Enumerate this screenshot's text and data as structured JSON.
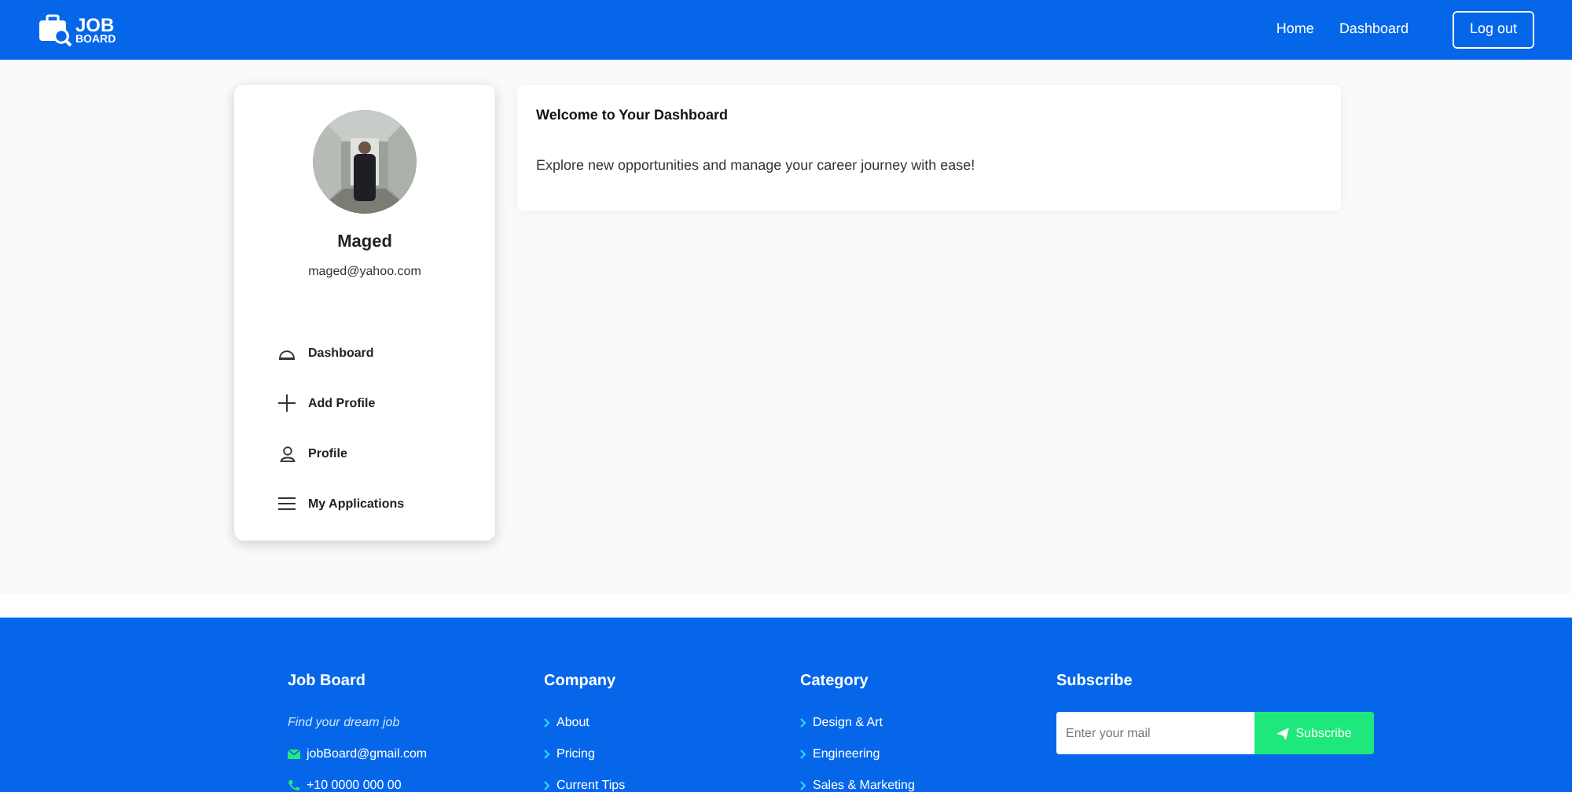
{
  "navbar": {
    "logo": {
      "line_1": "JOB",
      "line_2": "BOARD"
    },
    "links": [
      "Home",
      "Dashboard"
    ],
    "logout": "Log out"
  },
  "sidebar": {
    "name": "Maged",
    "email": "maged@yahoo.com",
    "items": [
      {
        "label": "Dashboard"
      },
      {
        "label": "Add Profile"
      },
      {
        "label": "Profile"
      },
      {
        "label": "My Applications"
      }
    ]
  },
  "welcome": {
    "title": "Welcome to Your Dashboard",
    "text": "Explore new opportunities and manage your career journey with ease!"
  },
  "footer": {
    "brand": {
      "title": "Job Board",
      "tagline": "Find your dream job",
      "email": "jobBoard@gmail.com",
      "phone": "+10 0000 000 00"
    },
    "company": {
      "title": "Company",
      "links": [
        "About",
        "Pricing",
        "Current Tips"
      ]
    },
    "category": {
      "title": "Category",
      "links": [
        "Design & Art",
        "Engineering",
        "Sales & Marketing"
      ]
    },
    "subscribe": {
      "title": "Subscribe",
      "placeholder": "Enter your mail",
      "button": "Subscribe"
    }
  }
}
